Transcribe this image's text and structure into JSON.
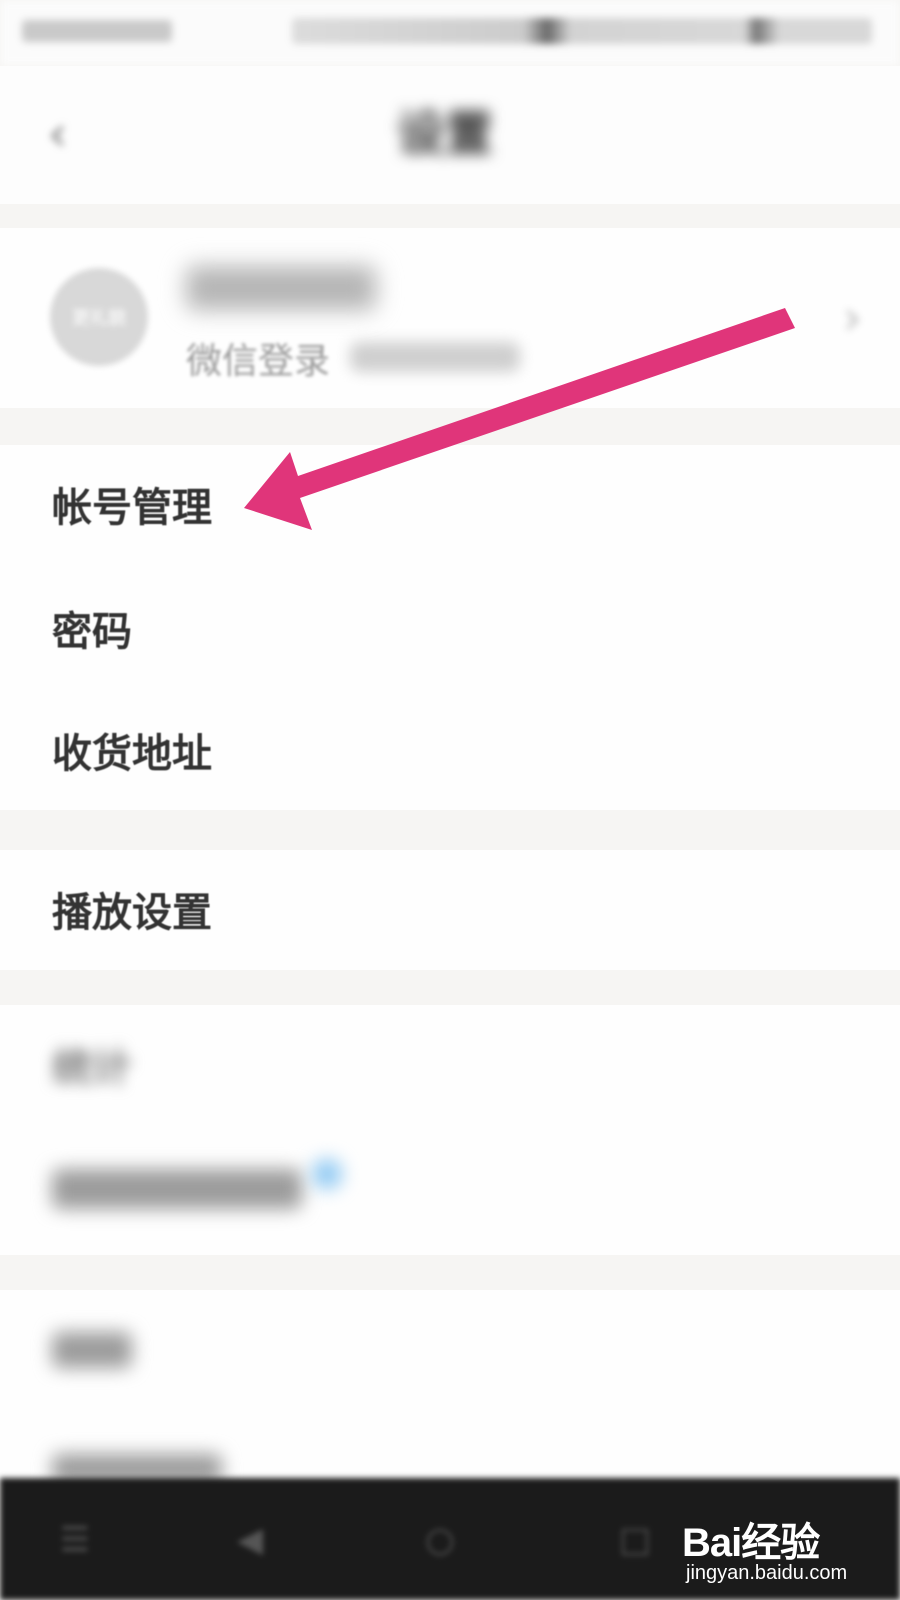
{
  "status_bar": {
    "carrier": "",
    "time": ""
  },
  "nav": {
    "title": "设置",
    "back_icon": "chevron-left-icon"
  },
  "profile": {
    "avatar_text": "更礼貌",
    "user_name": "",
    "login_method": "微信登录",
    "chevron_icon": "chevron-right-icon"
  },
  "menu_group_1": [
    {
      "label": "帐号管理"
    },
    {
      "label": "密码"
    },
    {
      "label": "收货地址"
    }
  ],
  "menu_group_2": [
    {
      "label": "播放设置"
    }
  ],
  "menu_group_3_blurred": [
    {
      "label": "统计"
    },
    {
      "label": ""
    }
  ],
  "menu_group_4_blurred": [
    {
      "label": ""
    },
    {
      "label": ""
    }
  ],
  "annotation": {
    "arrow_color": "#e0357a",
    "arrow_icon": "pointer-arrow-icon"
  },
  "bottom_nav": {
    "icons": [
      "menu-icon",
      "back-icon",
      "home-icon",
      "recents-icon"
    ]
  },
  "watermark": {
    "logo": "Bai经验",
    "url": "jingyan.baidu.com"
  }
}
